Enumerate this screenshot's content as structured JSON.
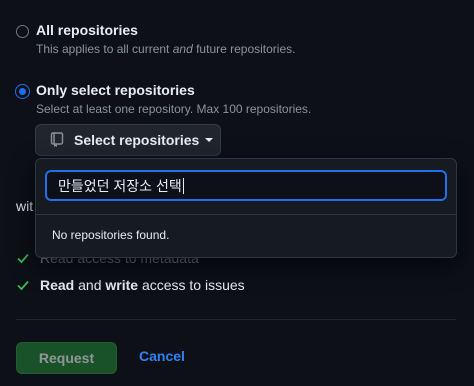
{
  "radios": {
    "all": {
      "title": "All repositories",
      "desc_prefix": "This applies to all current ",
      "desc_em": "and",
      "desc_suffix": " future repositories."
    },
    "select": {
      "title": "Only select repositories",
      "desc": "Select at least one repository. Max 100 repositories."
    }
  },
  "select_button": {
    "label": "Select repositories",
    "icon": "repo-icon"
  },
  "dropdown": {
    "search_value": "만들었던 저장소 선택",
    "empty_message": "No repositories found."
  },
  "partially_hidden": {
    "heading_fragment": "wit",
    "metadata_line_fragment": "Read access to metadata"
  },
  "permissions": {
    "issues": {
      "read": "Read",
      "and": " and ",
      "write": "write",
      "rest": " access to issues"
    }
  },
  "actions": {
    "request": "Request",
    "cancel": "Cancel"
  },
  "colors": {
    "background": "#0d1117",
    "accent": "#1f6feb",
    "check": "#3fb950",
    "primary_button": "#238636"
  }
}
